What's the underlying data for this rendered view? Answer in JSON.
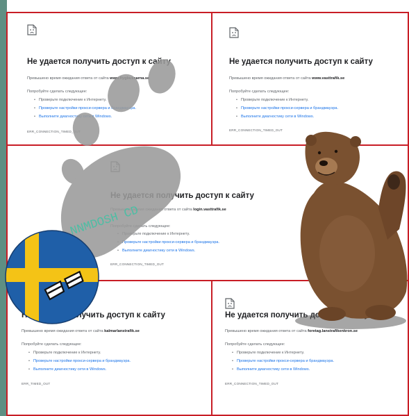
{
  "common": {
    "title": "Не удается получить доступ к сайту",
    "try_label": "Попробуйте сделать следующее:",
    "check_connection": "Проверьте подключение к Интернету.",
    "check_proxy": "Проверьте настройки прокси-сервера и брандмауэра.",
    "run_diagnostics": "Выполните диагностику сети в Windows.",
    "error_code_timed_out": "ERR_CONNECTION_TIMED_OUT",
    "error_code_short": "ERR_TIMED_OUT"
  },
  "panels": [
    {
      "prefix": "Превышено время ожидания ответа от сайта",
      "domain": "www.flygbussarna.se"
    },
    {
      "prefix": "Превышено время ожидания ответа от сайта",
      "domain": "www.vasttrafik.se"
    },
    {
      "prefix": "Превышено время ожидания ответа от сайта",
      "domain": "login.vasttrafik.se"
    },
    {
      "prefix": "Превышено время ожидания ответа от сайта",
      "domain": "kalmarlanstrafik.se"
    },
    {
      "prefix": "Превышено время ожидания ответа от сайта",
      "domain": "foretag.lanstrafikenkron.se"
    }
  ],
  "watermark": {
    "text": "NNMDOSH CD"
  },
  "colors": {
    "panel_border": "#c81d25",
    "link_blue": "#1a73e8",
    "title_text": "#202124",
    "body_text": "#5f6368",
    "paw_gray": "#9a9a9a",
    "flag_blue": "#1f5fa8",
    "flag_yellow": "#f4c316",
    "bear_brown": "#7a5130"
  },
  "icons": [
    "sad-document-icon",
    "paw-print-watermark",
    "sweden-flag-ball",
    "bear-sticker"
  ]
}
